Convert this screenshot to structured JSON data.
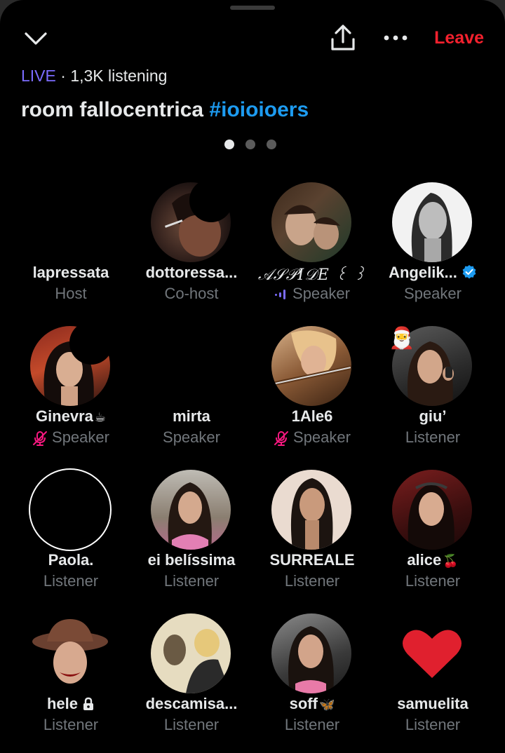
{
  "header": {
    "live_label": "LIVE",
    "listening": "· 1,3K listening",
    "title_text": "room fallocentrica",
    "title_tag": "#ioioioers",
    "leave_label": "Leave",
    "page_count": 3,
    "active_page": 1
  },
  "colors": {
    "live": "#7b6cff",
    "leave": "#f4212e",
    "hashtag": "#1d9bf0",
    "muted": "#71767b",
    "mic_off": "#f91880"
  },
  "participants": [
    {
      "name": "lapressata",
      "role": "Host",
      "reaction": "😂"
    },
    {
      "name": "dottoressa...",
      "role": "Co-host",
      "reaction": "😂"
    },
    {
      "name": "𝒜𝒮𝒫𝐼𝒟𝐸 ꒰ ꒱",
      "role": "Speaker",
      "icon": "speaking-bars-icon"
    },
    {
      "name": "Angelik...",
      "role": "Speaker",
      "verified": true
    },
    {
      "name": "Ginevra",
      "role": "Speaker",
      "emoji": "☕",
      "icon": "mic-off-icon",
      "reaction": "😂"
    },
    {
      "name": "mirta",
      "role": "Speaker",
      "reaction": "😂"
    },
    {
      "name": "1Ale6",
      "role": "Speaker",
      "icon": "mic-off-icon"
    },
    {
      "name": "giu’",
      "role": "Listener",
      "avatar_decoration": "🎅"
    },
    {
      "name": "Paola.",
      "role": "Listener",
      "reaction": "😂"
    },
    {
      "name": "ei belíssima",
      "role": "Listener"
    },
    {
      "name": "SURREALE",
      "role": "Listener"
    },
    {
      "name": "alice",
      "role": "Listener",
      "emoji": "🍒"
    },
    {
      "name": "hele",
      "role": "Listener",
      "emoji": "🔒"
    },
    {
      "name": "descamisa...",
      "role": "Listener"
    },
    {
      "name": "soff",
      "role": "Listener",
      "emoji": "🦋"
    },
    {
      "name": "samuelita",
      "role": "Listener",
      "emoji": "❤️"
    }
  ]
}
